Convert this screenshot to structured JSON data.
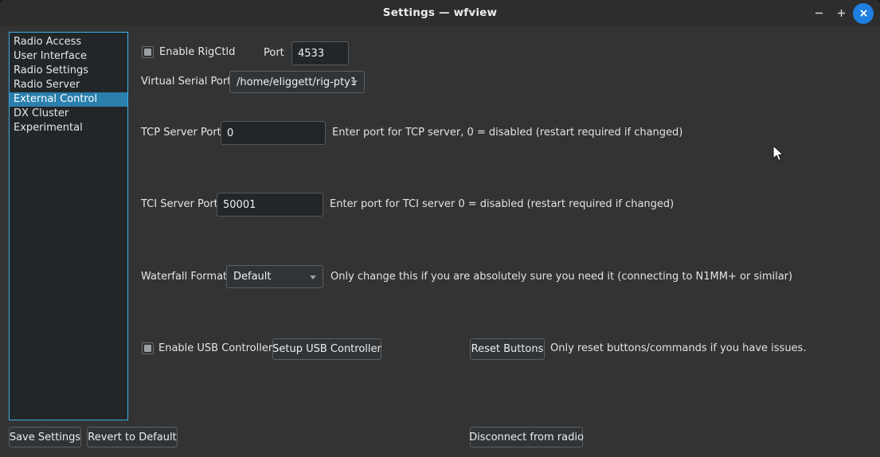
{
  "window": {
    "title": "Settings — wfview",
    "controls": {
      "minimize": "−",
      "maximize": "+",
      "close": "✕"
    }
  },
  "sidebar": {
    "items": [
      {
        "label": "Radio Access",
        "selected": false
      },
      {
        "label": "User Interface",
        "selected": false
      },
      {
        "label": "Radio Settings",
        "selected": false
      },
      {
        "label": "Radio Server",
        "selected": false
      },
      {
        "label": "External Control",
        "selected": true
      },
      {
        "label": "DX Cluster",
        "selected": false
      },
      {
        "label": "Experimental",
        "selected": false
      }
    ]
  },
  "main": {
    "rigctld": {
      "enable_label": "Enable RigCtld",
      "enabled": false,
      "port_label": "Port",
      "port_value": "4533"
    },
    "virtual_serial": {
      "label": "Virtual Serial Port",
      "value": "/home/eliggett/rig-pty1"
    },
    "tcp_server": {
      "label": "TCP Server Port",
      "value": "0",
      "hint": "Enter port for TCP server, 0 = disabled (restart required if changed)"
    },
    "tci_server": {
      "label": "TCI Server Port",
      "value": "50001",
      "hint": "Enter port for TCI server 0 = disabled (restart required if changed)"
    },
    "waterfall": {
      "label": "Waterfall Format",
      "value": "Default",
      "hint": "Only change this if you are absolutely sure you need it (connecting to N1MM+ or similar)"
    },
    "usb": {
      "enable_label": "Enable USB Controllers",
      "enabled": false,
      "setup_button": "Setup USB Controller",
      "reset_button": "Reset Buttons",
      "reset_hint": "Only reset buttons/commands if you have issues."
    }
  },
  "footer": {
    "save_label": "Save Settings",
    "revert_label": "Revert to Default",
    "disconnect_label": "Disconnect from radio"
  },
  "colors": {
    "window_background": "#333333",
    "titlebar": "#2d2d2d",
    "selection": "#2a7fad",
    "focus_border": "#3daee9",
    "close_button": "#1f7fe0",
    "field_background": "#232629"
  }
}
